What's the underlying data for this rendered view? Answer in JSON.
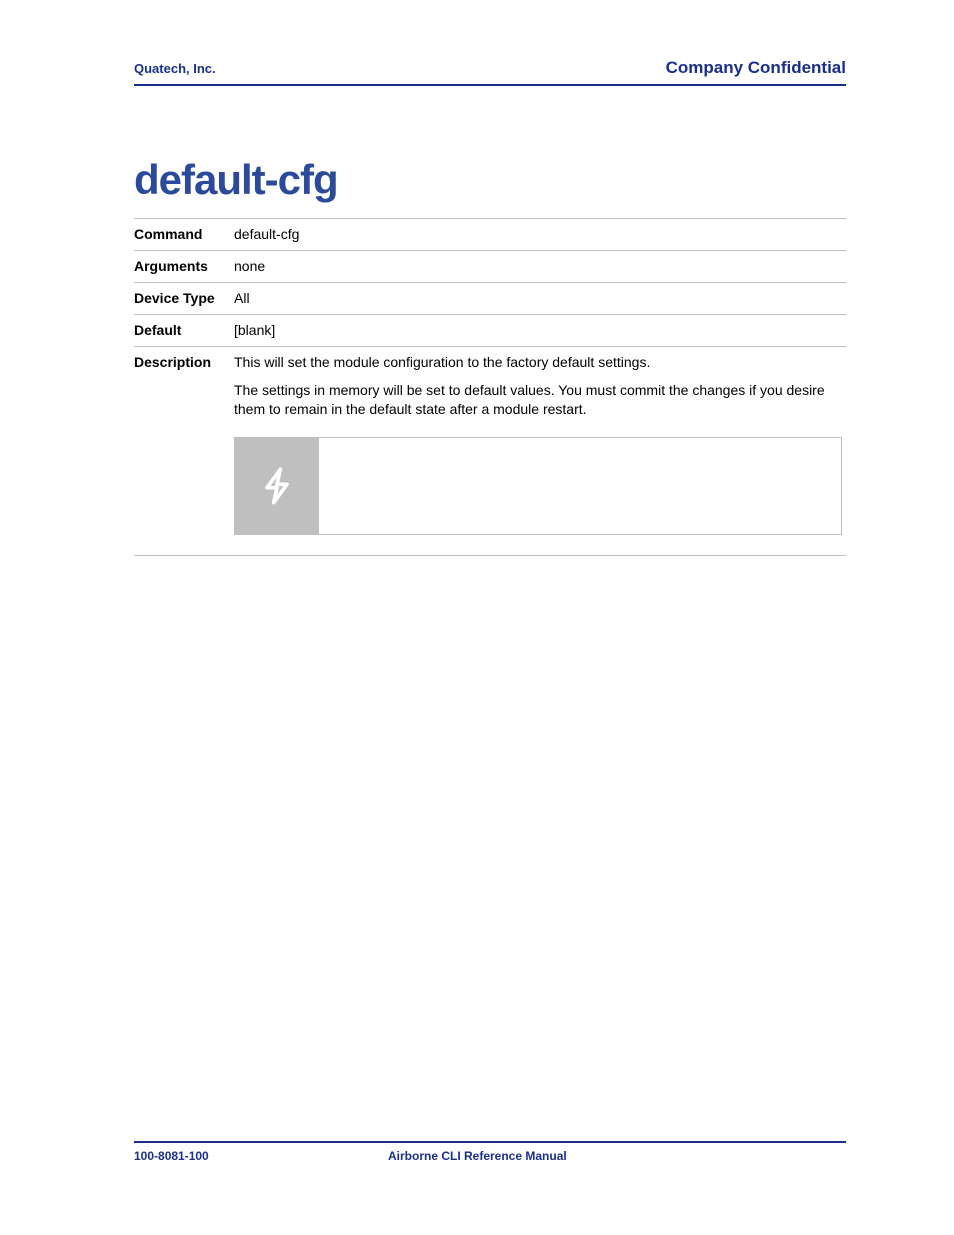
{
  "header": {
    "company": "Quatech, Inc.",
    "classification": "Company Confidential"
  },
  "title": "default-cfg",
  "rows": {
    "command": {
      "label": "Command",
      "value": "default-cfg"
    },
    "arguments": {
      "label": "Arguments",
      "value": "none"
    },
    "deviceType": {
      "label": "Device Type",
      "value": "All"
    },
    "default": {
      "label": "Default",
      "value": "[blank]"
    },
    "description": {
      "label": "Description",
      "para1": "This will set the module configuration to the factory default settings.",
      "para2": "The settings in memory will be set to default values. You must commit the changes if you desire them to remain in the default state after a module restart."
    }
  },
  "footer": {
    "docNumber": "100-8081-100",
    "docTitle": "Airborne CLI Reference Manual"
  }
}
